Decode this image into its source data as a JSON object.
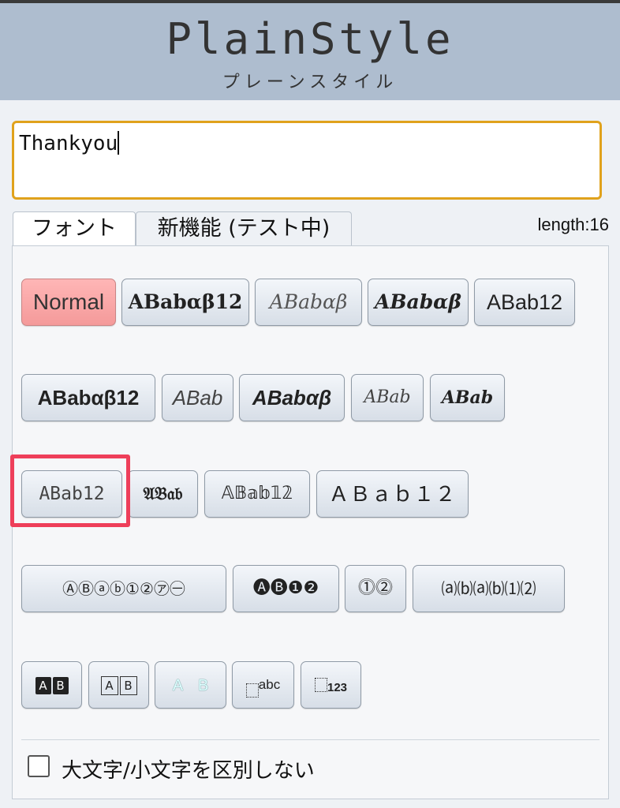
{
  "header": {
    "title": "PlainStyle",
    "subtitle": "プレーンスタイル"
  },
  "input": {
    "value": "Thankyou"
  },
  "tabs": [
    {
      "label": "フォント"
    },
    {
      "label": "新機能 (テスト中)"
    }
  ],
  "length_label": "length:16",
  "font_buttons": [
    {
      "label": "Normal",
      "state": "active"
    },
    {
      "label": "ABabαβ12"
    },
    {
      "label": "ABabαβ"
    },
    {
      "label": "ABabαβ"
    },
    {
      "label": "ABab12"
    },
    {
      "label": "ABabαβ12"
    },
    {
      "label": "ABab"
    },
    {
      "label": "ABabαβ"
    },
    {
      "label": "ABab"
    },
    {
      "label": "ABab"
    },
    {
      "label": "ABab12",
      "highlighted": true
    },
    {
      "label": "𝔄𝔅𝔞𝔟"
    },
    {
      "label": "𝔸𝔹𝕒𝕓𝟙𝟚"
    },
    {
      "label": "ＡＢａｂ１２"
    },
    {
      "label": "ⒶⒷⓐⓑ①②㋐㊀"
    },
    {
      "label": "🅐🅑❶❷"
    },
    {
      "label": "⓵⓶"
    },
    {
      "label": "⒜⒝⒜⒝⑴⑵"
    },
    {
      "a": "A",
      "b": "B"
    },
    {
      "a": "A",
      "b": "B"
    },
    {
      "a": "A",
      "b": "B"
    },
    {
      "label": "abc"
    },
    {
      "label": "123"
    }
  ],
  "accent_colors": {
    "header_bg": "#aebdcf",
    "input_border": "#e0a21c",
    "active_button": "#f49a9a",
    "highlight_box": "#ee3f5a"
  },
  "checkbox": {
    "label": "大文字/小文字を区別しない",
    "checked": false
  }
}
